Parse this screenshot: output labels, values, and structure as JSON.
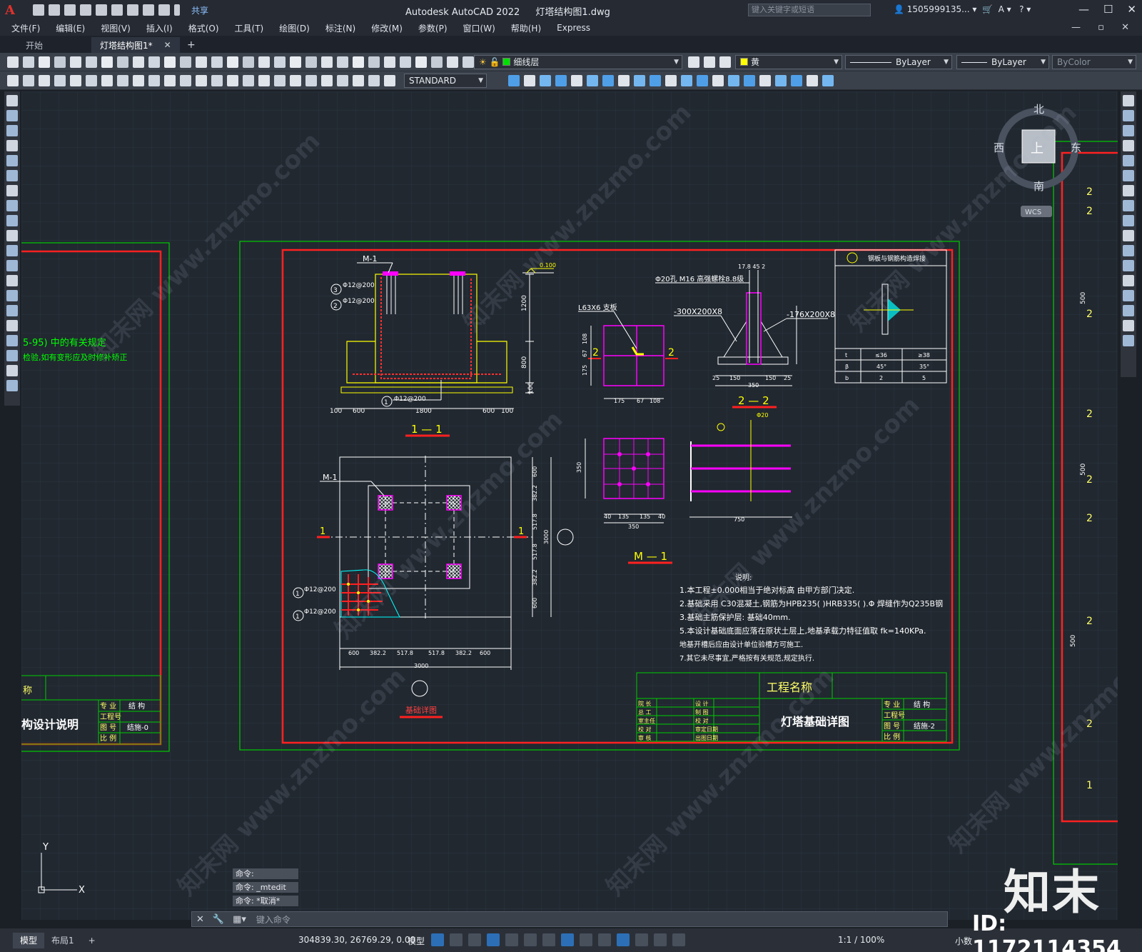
{
  "titlebar": {
    "app_logo": "A",
    "share_label": "共享",
    "app_name": "Autodesk AutoCAD 2022",
    "file_name": "灯塔结构图1.dwg",
    "search_placeholder": "键入关键字或短语",
    "user": "1505999135..."
  },
  "menu": [
    "文件(F)",
    "编辑(E)",
    "视图(V)",
    "插入(I)",
    "格式(O)",
    "工具(T)",
    "绘图(D)",
    "标注(N)",
    "修改(M)",
    "参数(P)",
    "窗口(W)",
    "帮助(H)",
    "Express"
  ],
  "tabs": {
    "start": "开始",
    "active": "灯塔结构图1*",
    "add": "+"
  },
  "toolbar": {
    "layer": "细线层",
    "color": "黄",
    "linetype": "ByLayer",
    "lineweight": "ByLayer",
    "plotstyle": "ByColor",
    "textstyle": "STANDARD",
    "colors": {
      "layer_swatch": "#00e000",
      "color_swatch": "#ffff00"
    }
  },
  "viewcube": {
    "north": "北",
    "south": "南",
    "east": "东",
    "west": "西",
    "face": "上",
    "wcs": "WCS"
  },
  "drawing": {
    "left_sheet": {
      "note1": "5-95) 中的有关规定",
      "note2": "检验,如有变形应及时修补矫正",
      "title_frag": "称",
      "doc_title": "构设计说明",
      "tb_rows": [
        [
          "专 业",
          "结 构"
        ],
        [
          "工程号",
          ""
        ],
        [
          "图 号",
          "结施-0"
        ],
        [
          "比 例",
          ""
        ]
      ]
    },
    "main_sheet": {
      "section_1_1": "1 — 1",
      "section_2_2": "2 — 2",
      "section_m_1": "M — 1",
      "plan_label": "基础详图",
      "m1_tag": "M-1",
      "elev": "0.100",
      "rebar_a": "Φ12@200",
      "rebar_b": "Φ12@200",
      "rebar_c": "Φ12@200",
      "dims_1_1": [
        "100",
        "600",
        "1800",
        "600",
        "100"
      ],
      "dims_v_1_1": [
        "1200",
        "800",
        "100"
      ],
      "dims_plan_h": [
        "600",
        "382.2",
        "517.8",
        "517.8",
        "382.2",
        "600"
      ],
      "dims_plan_v": [
        "600",
        "382.2",
        "517.8",
        "517.8",
        "382.2",
        "600"
      ],
      "dim_total": "3000",
      "angle_tag": "L63X6 支板",
      "bolt_tag": "Φ20孔 M16 高强螺栓8.8级",
      "plate1": "-300X200X8",
      "plate2": "-176X200X8",
      "dims_2_2": [
        "25",
        "150",
        "150",
        "25",
        "350"
      ],
      "dims_small": [
        "175",
        "67",
        "108"
      ],
      "dims_m1": [
        "40",
        "135",
        "135",
        "40",
        "350"
      ],
      "dim_750": "750",
      "phi20": "Φ20",
      "top_dims": "17.8 45 2",
      "detail_title": "钢板与钢筋构造焊接",
      "detail_table": [
        [
          "t",
          "≤36",
          "≥38"
        ],
        [
          "β",
          "45°",
          "35°"
        ],
        [
          "b",
          "2",
          "5"
        ]
      ],
      "notes_title": "说明:",
      "notes": [
        "1.本工程±0.000相当于绝对标高 由甲方部门决定.",
        "2.基础采用 C30混凝土,钢筋为HPB235( )HRB335( ).Φ  焊缝作为Q235B钢",
        "3.基础主筋保护层: 基础40mm.",
        "5.本设计基础底面应落在原状土层上,地基承载力特征值取 fk=140KPa.",
        "  地基开槽后应由设计单位验槽方可施工.",
        "7.其它未尽事宜,严格按有关规范,规定执行."
      ],
      "tb_project": "工程名称",
      "tb_drawing": "灯塔基础详图",
      "tb_sign_rows": [
        [
          "院 长",
          "设 计"
        ],
        [
          "总 工",
          "制 图"
        ],
        [
          "室主任",
          "校 对"
        ],
        [
          "校 对",
          "审定日期"
        ],
        [
          "审 核",
          "出图日期"
        ]
      ],
      "tb_right": [
        [
          "专 业",
          "结 构"
        ],
        [
          "工程号",
          ""
        ],
        [
          "图 号",
          "结施-2"
        ],
        [
          "比 例",
          ""
        ]
      ]
    },
    "right_sheet": {
      "marks": [
        "2",
        "2",
        "2",
        "2",
        "2",
        "2",
        "2",
        "2",
        "2",
        "2",
        "1"
      ],
      "dims": [
        "500",
        "500",
        "500"
      ]
    },
    "ucs": {
      "x": "X",
      "y": "Y"
    }
  },
  "command": {
    "history": [
      "命令:",
      "命令: _mtedit",
      "命令: *取消*"
    ],
    "placeholder": "键入命令"
  },
  "status": {
    "tabs": [
      "模型",
      "布局1",
      "+"
    ],
    "coords": "304839.30, 26769.29, 0.00",
    "model": "模型",
    "scale": "1:1 / 100%",
    "units": "小数"
  },
  "watermark": {
    "logo": "知末",
    "id": "ID: 1172114354",
    "diag": "知末网 www.znzmo.com"
  }
}
